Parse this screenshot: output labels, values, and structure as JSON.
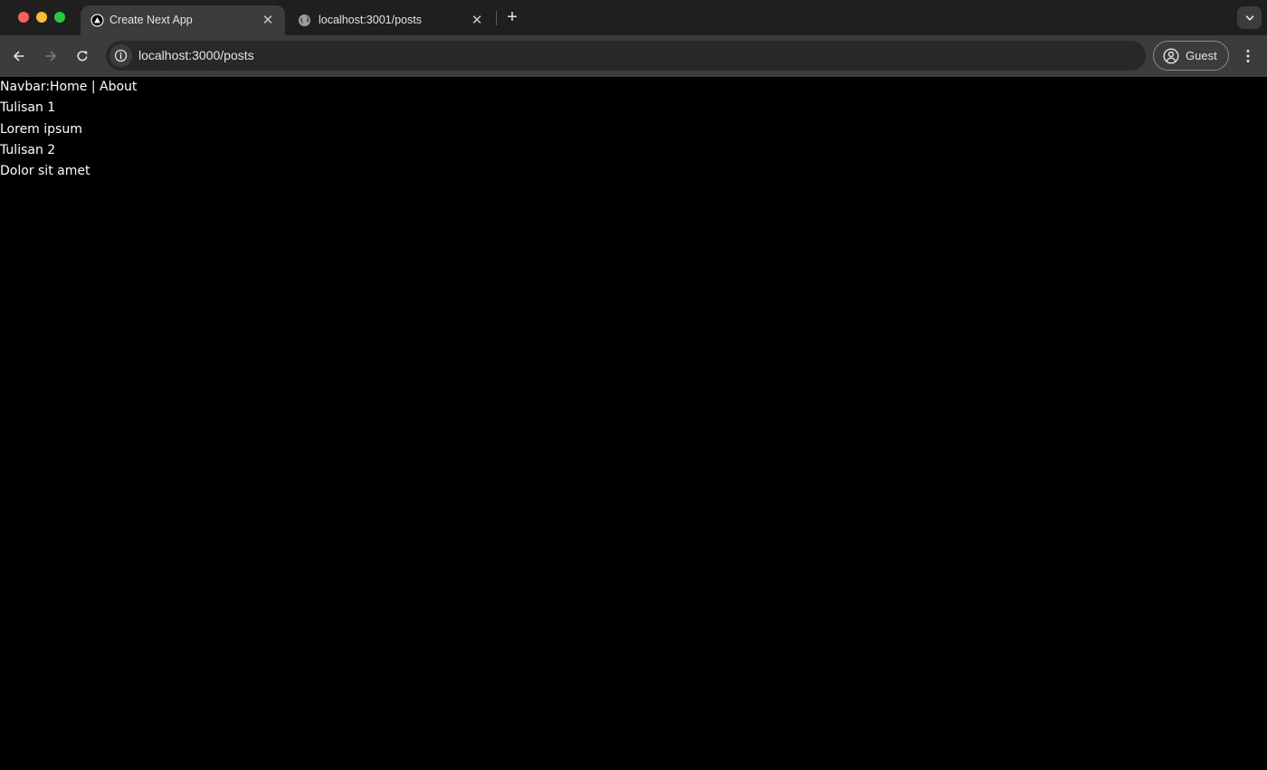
{
  "browser": {
    "tabs": [
      {
        "title": "Create Next App",
        "favicon": "nextjs-triangle-icon",
        "active": true
      },
      {
        "title": "localhost:3001/posts",
        "favicon": "globe-icon",
        "active": false
      }
    ],
    "address_bar": {
      "url": "localhost:3000/posts"
    },
    "profile": {
      "label": "Guest"
    }
  },
  "page": {
    "navbar": {
      "prefix": "Navbar:",
      "links": [
        {
          "label": "Home"
        },
        {
          "label": "About"
        }
      ],
      "separator": " | "
    },
    "posts": [
      {
        "title": "Tulisan 1",
        "body": "Lorem ipsum"
      },
      {
        "title": "Tulisan 2",
        "body": "Dolor sit amet"
      }
    ]
  },
  "colors": {
    "tabstrip": "#1f1f1f",
    "toolbar": "#3c3c3c",
    "omnibox": "#282828",
    "page_background": "#000000",
    "page_text": "#ffffff"
  }
}
